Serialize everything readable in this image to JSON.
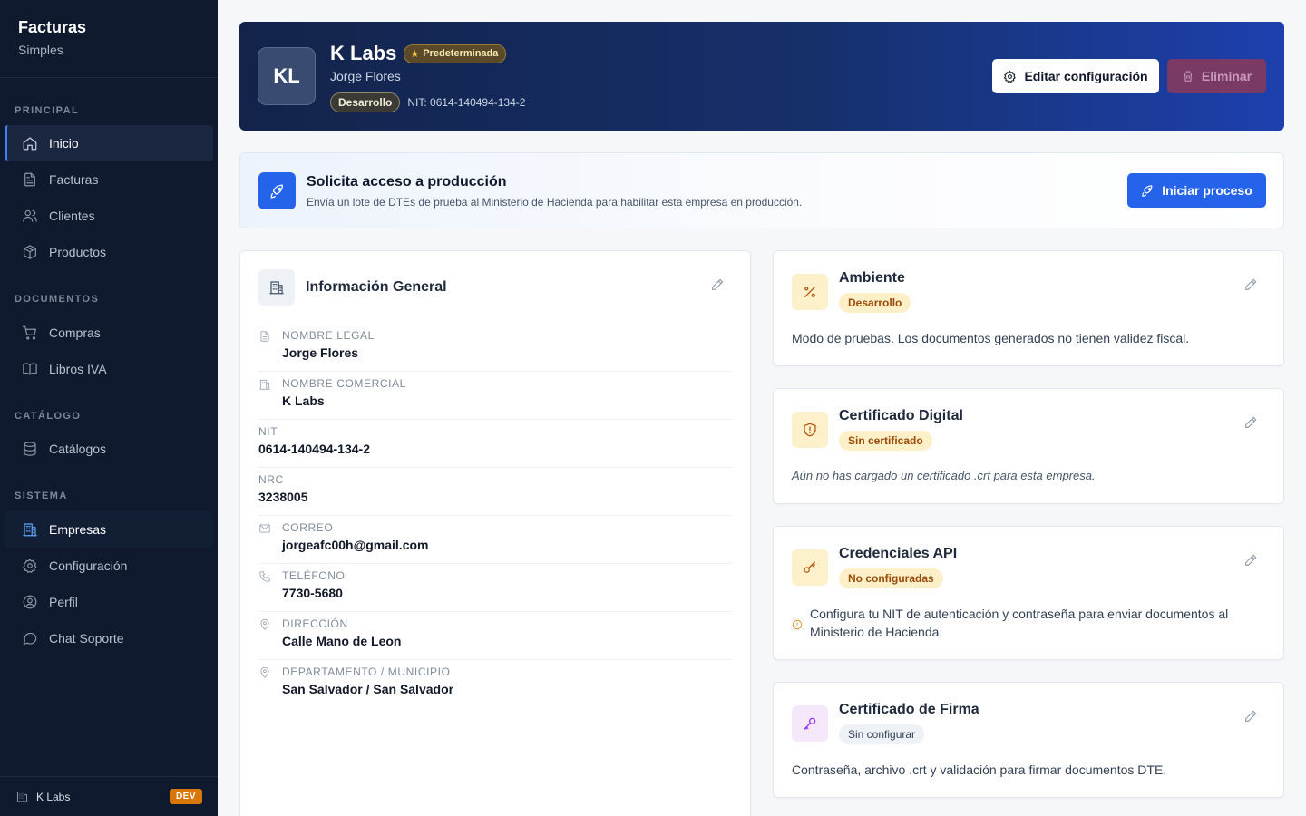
{
  "sidebar": {
    "brand_title": "Facturas",
    "brand_sub": "Simples",
    "sections": {
      "principal": "PRINCIPAL",
      "documentos": "DOCUMENTOS",
      "catalogo": "CATÁLOGO",
      "sistema": "SISTEMA"
    },
    "items": {
      "inicio": "Inicio",
      "facturas": "Facturas",
      "clientes": "Clientes",
      "productos": "Productos",
      "compras": "Compras",
      "libros": "Libros IVA",
      "catalogos": "Catálogos",
      "empresas": "Empresas",
      "configuracion": "Configuración",
      "perfil": "Perfil",
      "chat": "Chat Soporte"
    },
    "footer_company": "K Labs",
    "footer_badge": "DEV"
  },
  "hero": {
    "initials": "KL",
    "company": "K Labs",
    "default_badge": "Predeterminada",
    "owner": "Jorge Flores",
    "env_badge": "Desarrollo",
    "nit": "NIT: 0614-140494-134-2",
    "edit_label": "Editar configuración",
    "delete_label": "Eliminar"
  },
  "production": {
    "title": "Solicita acceso a producción",
    "description": "Envía un lote de DTEs de prueba al Ministerio de Hacienda para habilitar esta empresa en producción.",
    "button": "Iniciar proceso"
  },
  "info": {
    "title": "Información General",
    "fields": [
      {
        "label": "NOMBRE LEGAL",
        "value": "Jorge Flores"
      },
      {
        "label": "NOMBRE COMERCIAL",
        "value": "K Labs"
      },
      {
        "label": "NIT",
        "value": "0614-140494-134-2"
      },
      {
        "label": "NRC",
        "value": "3238005"
      },
      {
        "label": "CORREO",
        "value": "jorgeafc00h@gmail.com"
      },
      {
        "label": "TELÉFONO",
        "value": "7730-5680"
      },
      {
        "label": "DIRECCIÓN",
        "value": "Calle Mano de Leon"
      },
      {
        "label": "DEPARTAMENTO / MUNICIPIO",
        "value": "San Salvador / San Salvador"
      }
    ]
  },
  "cards": {
    "ambiente": {
      "title": "Ambiente",
      "badge": "Desarrollo",
      "text": "Modo de pruebas. Los documentos generados no tienen validez fiscal."
    },
    "certificado": {
      "title": "Certificado Digital",
      "badge": "Sin certificado",
      "text": "Aún no has cargado un certificado .crt para esta empresa."
    },
    "credenciales": {
      "title": "Credenciales API",
      "badge": "No configuradas",
      "text": "Configura tu NIT de autenticación y contraseña para enviar documentos al Ministerio de Hacienda."
    },
    "firma": {
      "title": "Certificado de Firma",
      "badge": "Sin configurar",
      "text": "Contraseña, archivo .crt y validación para firmar documentos DTE."
    }
  },
  "colors": {
    "sidebar_bg": "#0f1a2e",
    "accent": "#2563eb",
    "amber_badge_bg": "#fdefc7",
    "amber_badge_text": "#9a4b08",
    "purple_icon_bg": "#f6e8fb"
  }
}
